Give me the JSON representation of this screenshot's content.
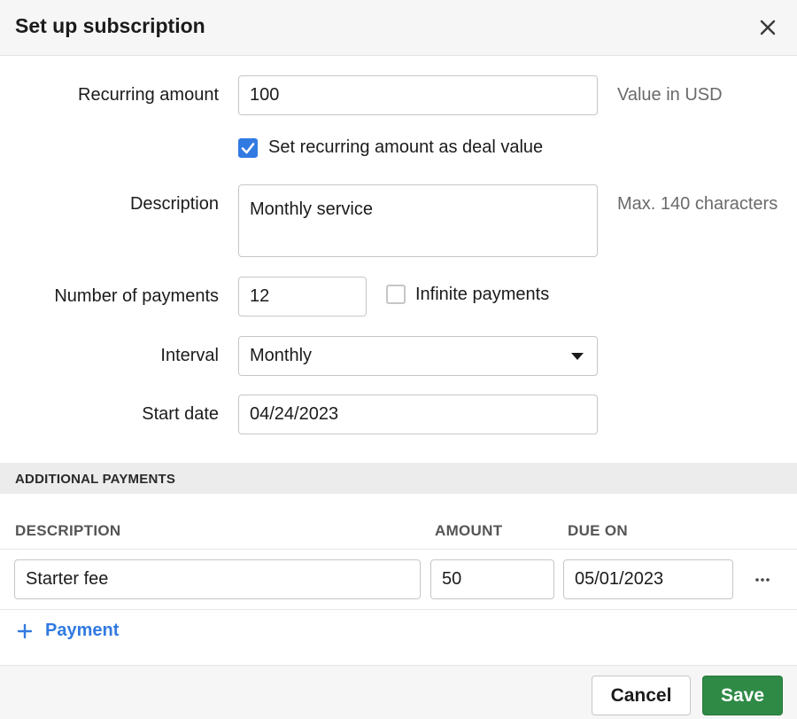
{
  "dialog": {
    "title": "Set up subscription",
    "close_icon": "close-icon"
  },
  "form": {
    "recurring_amount": {
      "label": "Recurring amount",
      "value": "100",
      "hint": "Value in USD"
    },
    "deal_value_checkbox": {
      "label": "Set recurring amount as deal value",
      "checked": true
    },
    "description": {
      "label": "Description",
      "value": "Monthly service",
      "hint": "Max. 140 characters"
    },
    "number_of_payments": {
      "label": "Number of payments",
      "value": "12"
    },
    "infinite_payments": {
      "label": "Infinite payments",
      "checked": false
    },
    "interval": {
      "label": "Interval",
      "value": "Monthly",
      "icon": "caret-down-icon"
    },
    "start_date": {
      "label": "Start date",
      "value": "04/24/2023"
    }
  },
  "additional_payments": {
    "section_title": "ADDITIONAL PAYMENTS",
    "columns": {
      "description": "DESCRIPTION",
      "amount": "AMOUNT",
      "due_on": "DUE ON"
    },
    "rows": [
      {
        "description": "Starter fee",
        "amount": "50",
        "due_on": "05/01/2023",
        "menu_icon": "more-horizontal-icon"
      }
    ],
    "add_label": "Payment",
    "add_icon": "plus-icon"
  },
  "footer": {
    "cancel_label": "Cancel",
    "save_label": "Save"
  },
  "colors": {
    "accent": "#317ae2",
    "save_button": "#2f8a46",
    "header_bg": "#f6f6f6",
    "section_bg": "#ececec"
  }
}
